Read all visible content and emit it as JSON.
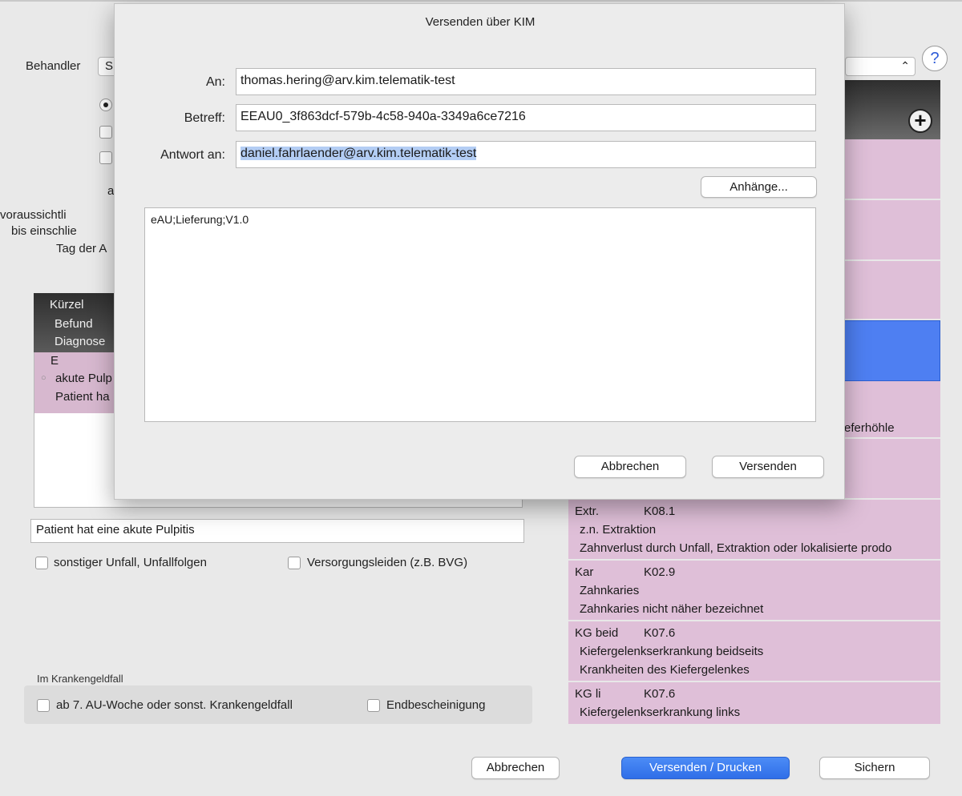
{
  "form": {
    "behandler_label": "Behandler",
    "behandler_value": "S",
    "label_a": "a",
    "label_voraussichtlich": "voraussichtli",
    "label_bis": "bis einschlie",
    "label_tag": "Tag der A",
    "table_headers": [
      "Kürzel",
      "Befund",
      "Diagnose"
    ],
    "table_row": {
      "code": "E",
      "line1": "akute Pulp",
      "line2": "Patient ha"
    },
    "diagnosis_text": "Patient hat eine akute Pulpitis",
    "checkbox_unfall": "sonstiger Unfall, Unfallfolgen",
    "checkbox_versorgung": "Versorgungsleiden (z.B. BVG)",
    "krankengeld_section": "Im Krankengeldfall",
    "checkbox_ab7": "ab 7. AU-Woche oder sonst. Krankengeldfall",
    "checkbox_end": "Endbescheinigung"
  },
  "right_panel": {
    "partial_text": "eferhöhle",
    "rows": [
      {
        "code": "Extr.",
        "icd": "K08.1",
        "line1": "z.n. Extraktion",
        "line2": "Zahnverlust durch Unfall, Extraktion oder lokalisierte prodo"
      },
      {
        "code": "Kar",
        "icd": "K02.9",
        "line1": "Zahnkaries",
        "line2": "Zahnkaries nicht näher bezeichnet"
      },
      {
        "code": "KG beid",
        "icd": "K07.6",
        "line1": "Kiefergelenkserkrankung beidseits",
        "line2": "Krankheiten des Kiefergelenkes"
      },
      {
        "code": "KG li",
        "icd": "K07.6",
        "line1": "Kiefergelenkserkrankung links",
        "line2": ""
      }
    ]
  },
  "bottom_buttons": {
    "cancel": "Abbrechen",
    "send_print": "Versenden / Drucken",
    "save": "Sichern"
  },
  "dialog": {
    "title": "Versenden über KIM",
    "to_label": "An:",
    "to_value": "thomas.hering@arv.kim.telematik-test",
    "subject_label": "Betreff:",
    "subject_value": "EEAU0_3f863dcf-579b-4c58-940a-3349a6ce7216",
    "reply_label": "Antwort an:",
    "reply_value": "daniel.fahrlaender@arv.kim.telematik-test",
    "attachments_button": "Anhänge...",
    "message_body": "eAU;Lieferung;V1.0",
    "cancel_button": "Abbrechen",
    "send_button": "Versenden"
  },
  "icons": {
    "help": "question-mark-icon",
    "add": "plus-circle-icon",
    "select": "up-down-chevron-icon"
  },
  "colors": {
    "accent": "#2f6ee8",
    "row_pink": "#dfbfd8",
    "row_selected": "#4e7ff2"
  }
}
